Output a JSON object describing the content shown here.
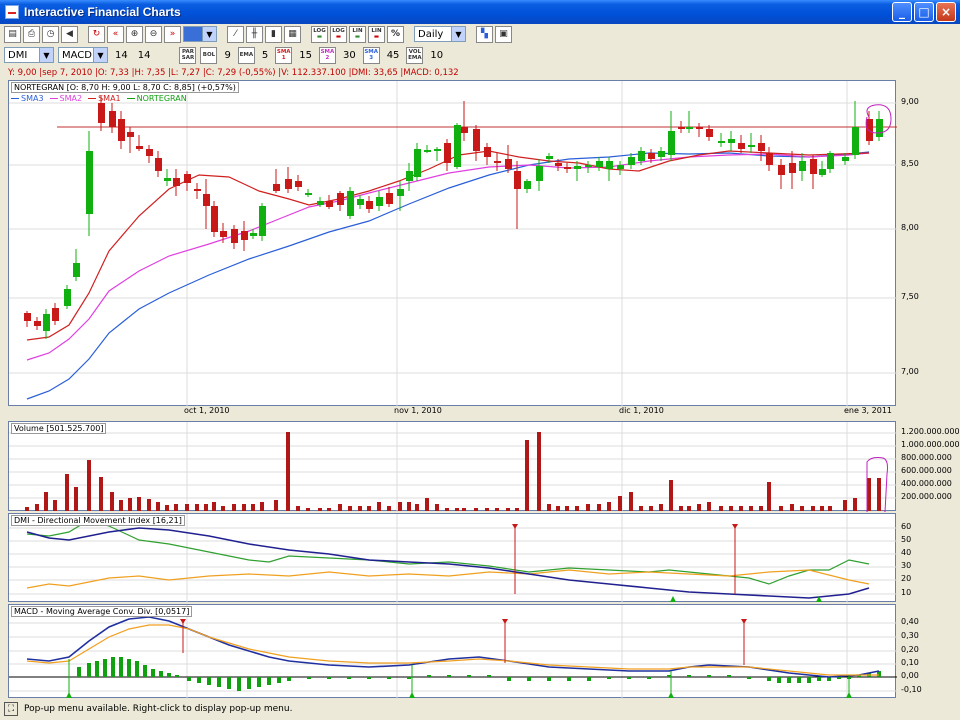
{
  "window": {
    "title": "Interactive Financial Charts",
    "minimize": "_",
    "maximize": "□",
    "close": "×"
  },
  "toolbar1": {
    "period": "Daily",
    "log_scale_label": "LOG",
    "log_volume_label": "LOG",
    "lin_scale_label": "LIN",
    "lin_volume_label": "LIN",
    "percent_label": "%"
  },
  "toolbar2": {
    "indicator1": "DMI",
    "indicator2": "MACD",
    "indicator1_param": "14",
    "indicator2_param": "14",
    "parsar_label": "PAR SAR",
    "bol_label": "BOL",
    "bol_param": "9",
    "ema_label": "EMA",
    "ema_param": "5",
    "sma1_label": "SMA 1",
    "sma1_param": "15",
    "sma2_label": "SMA 2",
    "sma2_param": "30",
    "sma3_label": "SMA 3",
    "sma3_param": "45",
    "volema_label": "VOL EMA",
    "volema_param": "10"
  },
  "info_line": "Y: 9,00 |sep 7, 2010 |O: 7,33 |H: 7,35 |L: 7,27 |C: 7,29 (-0,55%) |V: 112.337.100 |DMI: 33,65 |MACD: 0,132",
  "price_panel": {
    "header": "NORTEGRAN [O: 8,70  H: 9,00  L: 8,70  C: 8,85] (+0,57%)",
    "legend": [
      {
        "name": "SMA3",
        "color": "#2a5fd8"
      },
      {
        "name": "SMA2",
        "color": "#e040e0"
      },
      {
        "name": "SMA1",
        "color": "#d02020"
      },
      {
        "name": "NORTEGRAN",
        "color": "#10a010"
      }
    ],
    "y_ticks": [
      "9,00",
      "8,50",
      "8,00",
      "7,50",
      "7,00"
    ],
    "x_ticks": [
      "oct 1, 2010",
      "nov 1, 2010",
      "dic 1, 2010",
      "ene 3, 2011"
    ]
  },
  "volume_panel": {
    "header": "Volume [501.525.700]",
    "y_ticks": [
      "1.200.000.000",
      "1.000.000.000",
      "800.000.000",
      "600.000.000",
      "400.000.000",
      "200.000.000"
    ]
  },
  "dmi_panel": {
    "header": "DMI - Directional Movement Index [16,21]",
    "y_ticks": [
      "60",
      "50",
      "40",
      "30",
      "20",
      "10"
    ]
  },
  "macd_panel": {
    "header": "MACD - Moving Average Conv. Div. [0,0517]",
    "y_ticks": [
      "0,40",
      "0,30",
      "0,20",
      "0,10",
      "0,00",
      "-0,10"
    ]
  },
  "status": {
    "text": "Pop-up menu available. Right-click to display pop-up menu."
  }
}
